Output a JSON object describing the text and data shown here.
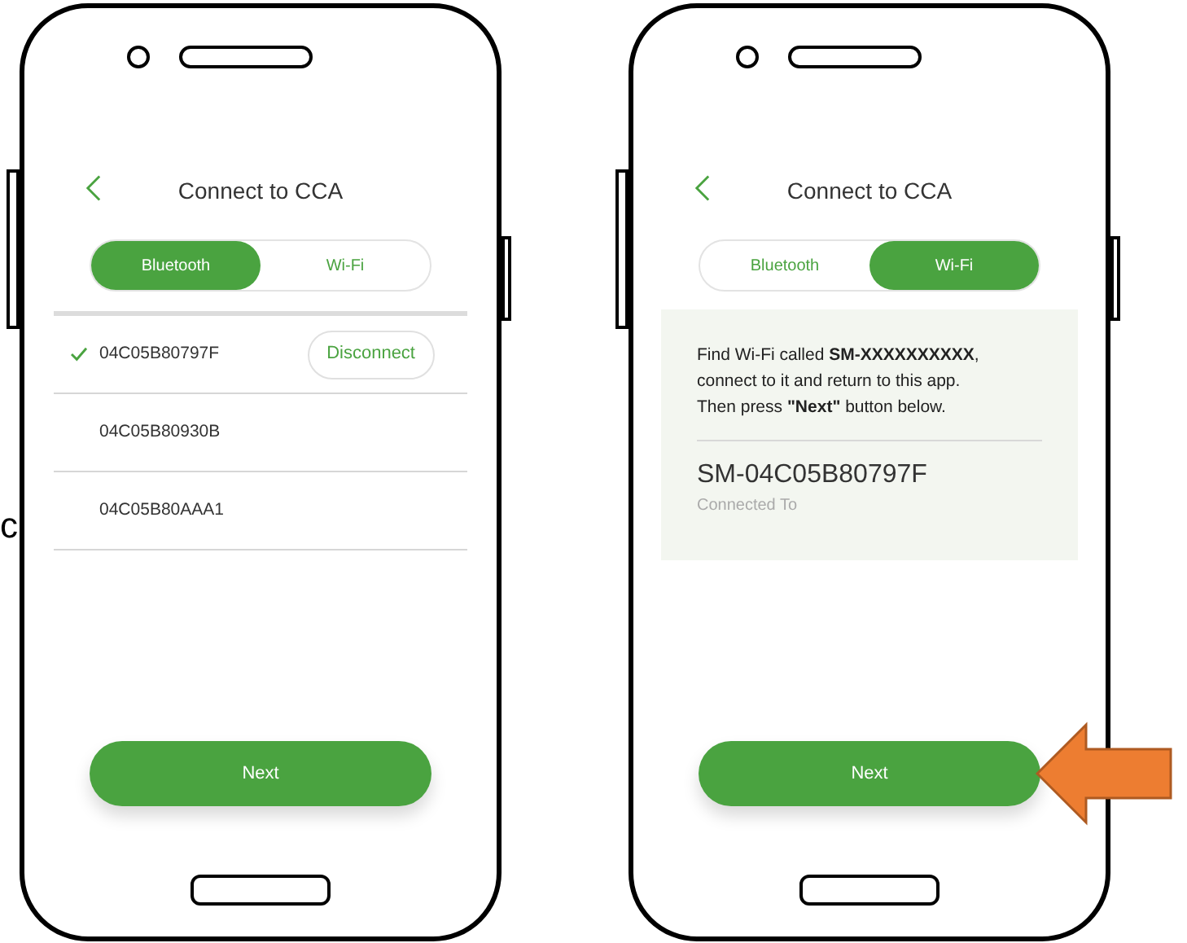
{
  "fragment": "c",
  "screens": [
    {
      "kind": "bluetooth",
      "title": "Connect to CCA",
      "tabs": [
        {
          "label": "Bluetooth",
          "selected": true
        },
        {
          "label": "Wi-Fi",
          "selected": false
        }
      ],
      "devices": [
        {
          "name": "04C05B80797F",
          "connected": true,
          "action": "Disconnect"
        },
        {
          "name": "04C05B80930B",
          "connected": false
        },
        {
          "name": "04C05B80AAA1",
          "connected": false
        }
      ],
      "button": "Next",
      "pointer_arrow": false
    },
    {
      "kind": "wifi",
      "title": "Connect to CCA",
      "tabs": [
        {
          "label": "Bluetooth",
          "selected": false
        },
        {
          "label": "Wi-Fi",
          "selected": true
        }
      ],
      "instructions": "Find Wi-Fi called **SM-XXXXXXXXXX**,\nconnect to it and return to this app.\nThen press **\"Next\"** button below.",
      "network": "SM-04C05B80797F",
      "network_caption": "Connected To",
      "button": "Next",
      "pointer_arrow": true
    }
  ]
}
